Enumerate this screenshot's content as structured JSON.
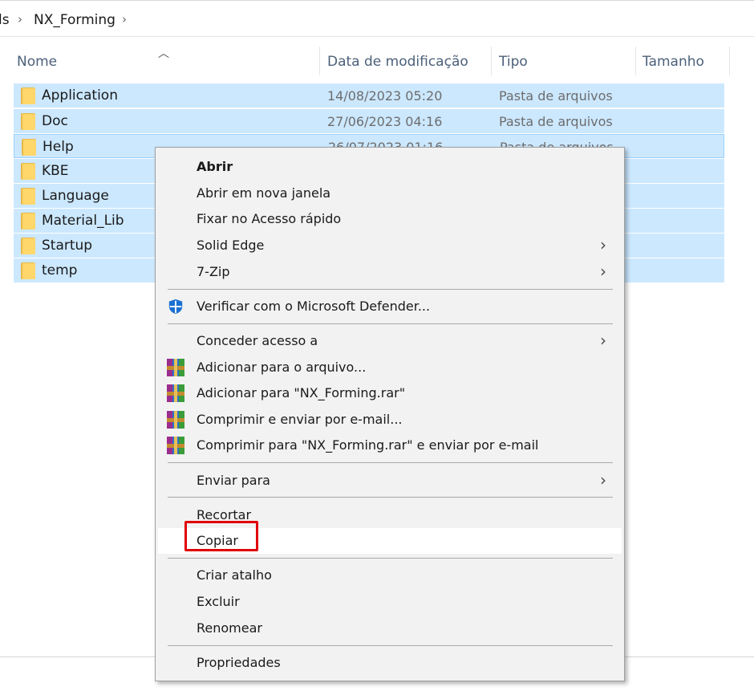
{
  "breadcrumb": {
    "partial": "ls",
    "current": "NX_Forming"
  },
  "columns": {
    "name": "Nome",
    "date": "Data de modificação",
    "type": "Tipo",
    "size": "Tamanho"
  },
  "files": [
    {
      "name": "Application",
      "date": "14/08/2023 05:20",
      "type": "Pasta de arquivos"
    },
    {
      "name": "Doc",
      "date": "27/06/2023 04:16",
      "type": "Pasta de arquivos"
    },
    {
      "name": "Help",
      "date": "26/07/2023 01:16",
      "type": "Pasta de arquivos"
    },
    {
      "name": "KBE",
      "date": "",
      "type": ""
    },
    {
      "name": "Language",
      "date": "",
      "type": ""
    },
    {
      "name": "Material_Lib",
      "date": "",
      "type": ""
    },
    {
      "name": "Startup",
      "date": "",
      "type": ""
    },
    {
      "name": "temp",
      "date": "",
      "type": ""
    }
  ],
  "context_menu": {
    "open": "Abrir",
    "open_new_window": "Abrir em nova janela",
    "pin_quick_access": "Fixar no Acesso rápido",
    "solid_edge": "Solid Edge",
    "seven_zip": "7-Zip",
    "defender": "Verificar com o Microsoft Defender...",
    "give_access": "Conceder acesso a",
    "add_to_archive": "Adicionar para o arquivo...",
    "add_to_rar": "Adicionar para \"NX_Forming.rar\"",
    "compress_email": "Comprimir e enviar por e-mail...",
    "compress_rar_email": "Comprimir para \"NX_Forming.rar\" e enviar por e-mail",
    "send_to": "Enviar para",
    "cut": "Recortar",
    "copy": "Copiar",
    "create_shortcut": "Criar atalho",
    "delete": "Excluir",
    "rename": "Renomear",
    "properties": "Propriedades"
  },
  "colors": {
    "selection": "#cce8ff",
    "highlight_border": "#e00000",
    "folder": "#ffd76a"
  }
}
